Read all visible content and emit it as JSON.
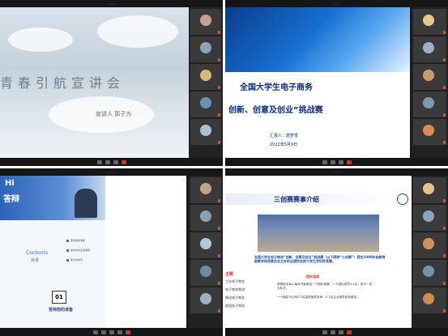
{
  "q1": {
    "title": "青春引航宣讲会",
    "speaker": "宣讲人   郭子为"
  },
  "q2": {
    "title_line1": "全国大学生电子商务",
    "title_line2": "创新、创意及创业”挑战赛",
    "reporter": "汇报人：唐梦雪",
    "date": "2022年5月9日"
  },
  "q3": {
    "hi": "Hi",
    "debate": "答辩",
    "contents": "Contents",
    "toc": "目录",
    "items": [
      "答辩前的准备",
      "答辩中的注意事项",
      "答辩的技巧"
    ],
    "num": "01",
    "section": "答辩前的准备"
  },
  "q4": {
    "title": "三创赛赛事介绍",
    "intro": "全国大学生电子商务“创新、创意及创业”挑战赛（以下简称“三创赛”）是在2009年由教育部教学指导委员会主办的全国性在校大学生学科性竞赛。",
    "side_label": "主题",
    "categories": [
      "工业电子商务",
      "电子商务物流",
      "移动电子商务",
      "校园电子商务"
    ],
    "team_label": "团队组成",
    "team_rules": [
      "参赛选手每人每年只能参加一个团队竞赛，一个团队成员3-5名，其中一名为队长。",
      "一个团队可以有0-2名高校指导老师、0-2名企业指导老师参加。"
    ]
  },
  "colors": {
    "meeting_bg": "#1b1b1b",
    "title_blue": "#0e2f79",
    "accent_red": "#d4332b"
  }
}
